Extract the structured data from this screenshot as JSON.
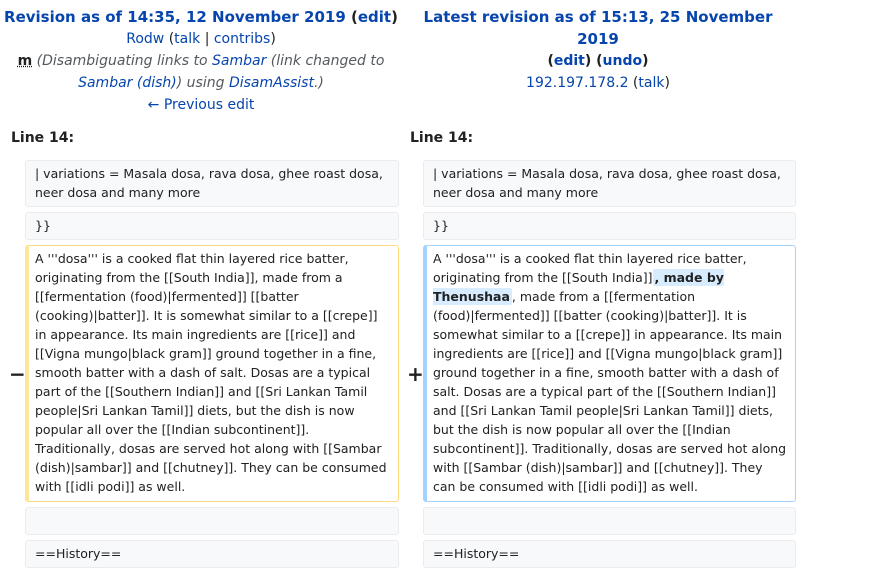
{
  "left_header": {
    "title_link": "Revision as of 14:35, 12 November 2019",
    "edit_link": "edit",
    "user": "Rodw",
    "talk": "talk",
    "contribs": "contribs",
    "minor_flag": "m",
    "summary_pre": "(Disambiguating links to ",
    "summary_link1": "Sambar",
    "summary_mid1": " (link changed to ",
    "summary_link2": "Sambar (dish)",
    "summary_mid2": ") using ",
    "summary_link3": "DisamAssist",
    "summary_post": ".)",
    "prev_edit": "← Previous edit"
  },
  "right_header": {
    "title_link": "Latest revision as of 15:13, 25 November 2019",
    "edit_link": "edit",
    "undo_link": "undo",
    "user_ip": "192.197.178.2",
    "talk": "talk"
  },
  "left_line_label": "Line 14:",
  "right_line_label": "Line 14:",
  "context_rows": {
    "variations": "| variations = Masala dosa, rava dosa, ghee roast dosa, neer dosa and many more",
    "braces": "}}",
    "history": "==History=="
  },
  "deleted_text": "A '''dosa''' is a cooked flat thin layered rice batter, originating from the [[South India]], made from a [[fermentation (food)|fermented]] [[batter (cooking)|batter]]. It is somewhat similar to a [[crepe]] in appearance. Its main ingredients are [[rice]] and [[Vigna mungo|black gram]] ground together in a fine, smooth batter with a dash of salt. Dosas are a typical part of the [[Southern Indian]] and [[Sri Lankan Tamil people|Sri Lankan Tamil]] diets, but the dish is now popular all over the [[Indian subcontinent]]. Traditionally, dosas are served hot along with [[Sambar (dish)|sambar]] and [[chutney]]. They can be consumed with [[idli podi]] as well.",
  "added_text_before": "A '''dosa''' is a cooked flat thin layered rice batter, originating from the [[South India]]",
  "added_text_inserted": ", made by Thenushaa",
  "added_text_after": ", made from a [[fermentation (food)|fermented]] [[batter (cooking)|batter]]. It is somewhat similar to a [[crepe]] in appearance. Its main ingredients are [[rice]] and [[Vigna mungo|black gram]] ground together in a fine, smooth batter with a dash of salt. Dosas are a typical part of the [[Southern Indian]] and [[Sri Lankan Tamil people|Sri Lankan Tamil]] diets, but the dish is now popular all over the [[Indian subcontinent]]. Traditionally, dosas are served hot along with [[Sambar (dish)|sambar]] and [[chutney]]. They can be consumed with [[idli podi]] as well.",
  "markers": {
    "minus": "−",
    "plus": "+"
  }
}
